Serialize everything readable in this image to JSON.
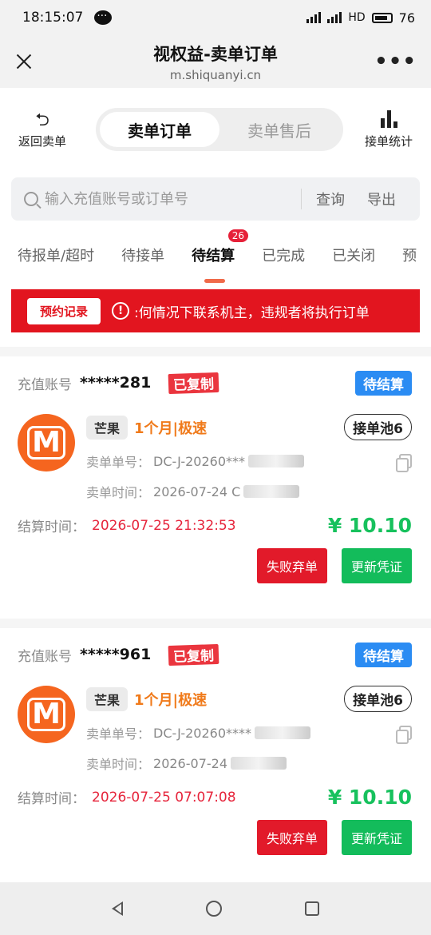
{
  "status_bar": {
    "time": "18:15:07",
    "network": "HD",
    "battery": "76"
  },
  "header": {
    "title": "视权益-卖单订单",
    "url": "m.shiquanyi.cn"
  },
  "topnav": {
    "back_label": "返回卖单",
    "segments": [
      "卖单订单",
      "卖单售后"
    ],
    "stats_label": "接单统计"
  },
  "search": {
    "placeholder": "输入充值账号或订单号",
    "query_label": "查询",
    "export_label": "导出"
  },
  "tabs": [
    {
      "label": "待报单/超时"
    },
    {
      "label": "待接单"
    },
    {
      "label": "待结算",
      "badge": "26"
    },
    {
      "label": "已完成"
    },
    {
      "label": "已关闭"
    },
    {
      "label": "预"
    }
  ],
  "notice": {
    "button_label": "预约记录",
    "message": ":何情况下联系机主，违规者将执行订单"
  },
  "orders": [
    {
      "account_label": "充值账号",
      "account": "*****281",
      "copied_label": "已复制",
      "status": "待结算",
      "chip": "芒果",
      "plan": "1个月|极速",
      "pool": "接单池6",
      "order_no_label": "卖单单号：",
      "order_no": "DC-J-20260***",
      "order_time_label": "卖单时间：",
      "order_time": "2026-07-24 C",
      "settle_label": "结算时间：",
      "settle_time": "2026-07-25 21:32:53",
      "price": "¥ 10.10",
      "fail_label": "失败弃单",
      "update_label": "更新凭证"
    },
    {
      "account_label": "充值账号",
      "account": "*****961",
      "copied_label": "已复制",
      "status": "待结算",
      "chip": "芒果",
      "plan": "1个月|极速",
      "pool": "接单池6",
      "order_no_label": "卖单单号：",
      "order_no": "DC-J-20260****",
      "order_time_label": "卖单时间：",
      "order_time": "2026-07-24",
      "settle_label": "结算时间：",
      "settle_time": "2026-07-25 07:07:08",
      "price": "¥ 10.10",
      "fail_label": "失败弃单",
      "update_label": "更新凭证"
    }
  ],
  "colors": {
    "accent_red": "#e2151f",
    "status_blue": "#2b8cf3",
    "price_green": "#17c15d",
    "plan_orange": "#f07a1a",
    "logo_orange": "#f5651f"
  },
  "icons": [
    "close-icon",
    "more-icon",
    "back-arrow-icon",
    "bar-chart-icon",
    "search-icon",
    "info-icon",
    "copy-icon",
    "mango-tv-logo"
  ]
}
